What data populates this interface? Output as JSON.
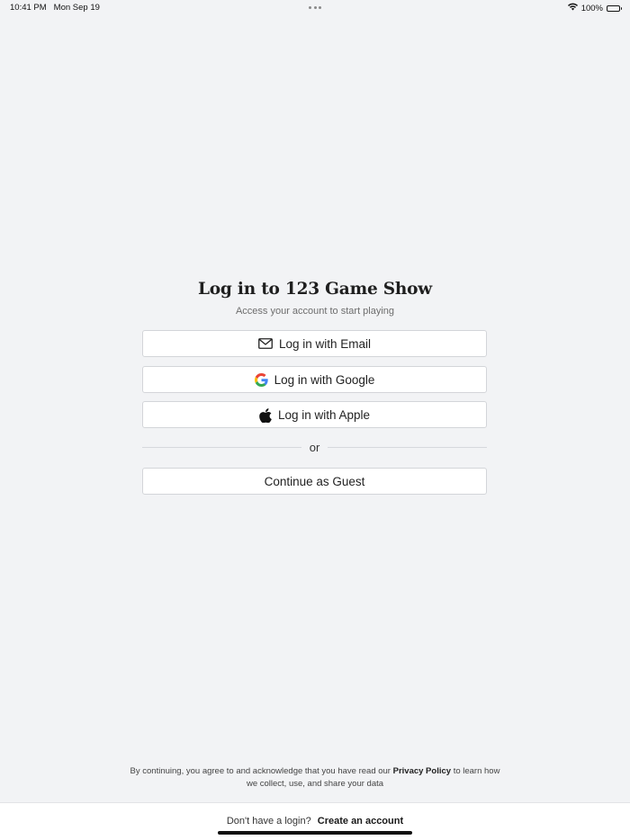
{
  "status_bar": {
    "time": "10:41 PM",
    "date": "Mon Sep 19",
    "battery": "100%"
  },
  "login": {
    "title": "Log in to 123 Game Show",
    "subtitle": "Access your account to start playing",
    "email_label": "Log in with Email",
    "google_label": "Log in with Google",
    "apple_label": "Log in with Apple",
    "divider_label": "or",
    "guest_label": "Continue as Guest"
  },
  "legal": {
    "prefix": "By continuing, you agree to and acknowledge that you have read our",
    "privacy_link": "Privacy Policy",
    "suffix": "to learn how we collect, use, and share your data"
  },
  "footer": {
    "prompt": "Don't have a login?",
    "create_label": "Create an account"
  },
  "colors": {
    "background": "#f2f3f5",
    "button_bg": "#ffffff",
    "button_border": "#d3d5d9",
    "google_blue": "#4285F4",
    "google_red": "#EA4335",
    "google_yellow": "#FBBC05",
    "google_green": "#34A853"
  },
  "icons": {
    "email": "envelope-icon",
    "google": "google-logo-icon",
    "apple": "apple-logo-icon",
    "wifi": "wifi-icon",
    "battery": "battery-icon",
    "multitasking": "more-dots-icon"
  }
}
